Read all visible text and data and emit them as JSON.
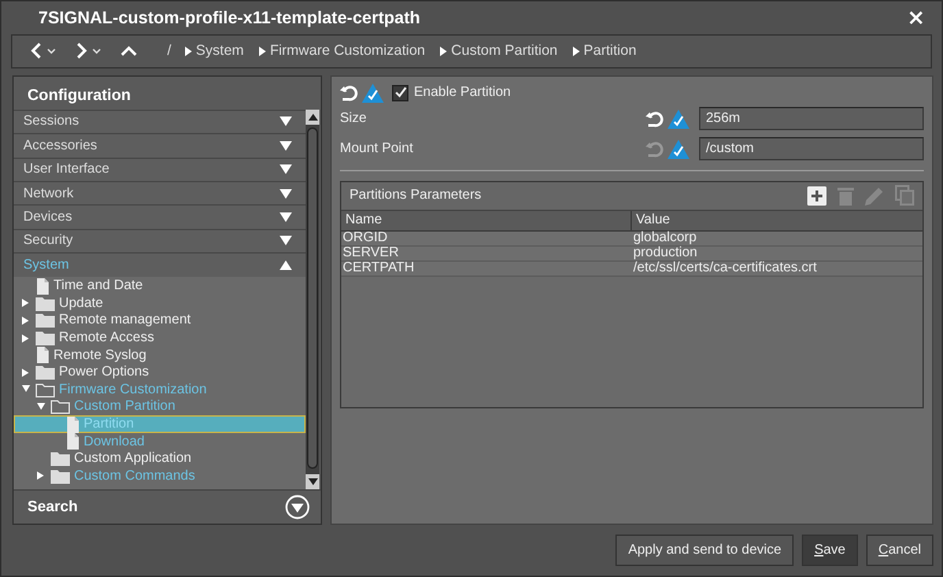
{
  "window": {
    "title": "7SIGNAL-custom-profile-x11-template-certpath",
    "close": "×"
  },
  "breadcrumb": {
    "root": "/",
    "items": [
      "System",
      "Firmware Customization",
      "Custom Partition",
      "Partition"
    ]
  },
  "sidebar": {
    "title": "Configuration",
    "categories": [
      {
        "label": "Sessions",
        "expanded": false
      },
      {
        "label": "Accessories",
        "expanded": false
      },
      {
        "label": "User Interface",
        "expanded": false
      },
      {
        "label": "Network",
        "expanded": false
      },
      {
        "label": "Devices",
        "expanded": false
      },
      {
        "label": "Security",
        "expanded": false
      },
      {
        "label": "System",
        "expanded": true
      }
    ],
    "tree": [
      {
        "label": "Time and Date",
        "kind": "file",
        "expandable": false,
        "modified": false,
        "selected": false
      },
      {
        "label": "Update",
        "kind": "folder",
        "expandable": true,
        "expanded": false,
        "modified": false,
        "selected": false
      },
      {
        "label": "Remote management",
        "kind": "folder",
        "expandable": true,
        "expanded": false,
        "modified": false,
        "selected": false
      },
      {
        "label": "Remote Access",
        "kind": "folder",
        "expandable": true,
        "expanded": false,
        "modified": false,
        "selected": false
      },
      {
        "label": "Remote Syslog",
        "kind": "file",
        "expandable": false,
        "modified": false,
        "selected": false
      },
      {
        "label": "Power Options",
        "kind": "folder",
        "expandable": true,
        "expanded": false,
        "modified": false,
        "selected": false
      },
      {
        "label": "Firmware Customization",
        "kind": "folder",
        "expandable": true,
        "expanded": true,
        "modified": true,
        "selected": false,
        "children": [
          {
            "label": "Custom Partition",
            "kind": "folder",
            "expandable": true,
            "expanded": true,
            "modified": true,
            "selected": false,
            "children": [
              {
                "label": "Partition",
                "kind": "file",
                "expandable": false,
                "modified": true,
                "selected": true
              },
              {
                "label": "Download",
                "kind": "file",
                "expandable": false,
                "modified": true,
                "selected": false
              }
            ]
          },
          {
            "label": "Custom Application",
            "kind": "folder",
            "expandable": false,
            "modified": false,
            "selected": false
          },
          {
            "label": "Custom Commands",
            "kind": "folder",
            "expandable": true,
            "expanded": false,
            "modified": true,
            "selected": false
          }
        ]
      }
    ],
    "search": "Search"
  },
  "enable_partition": {
    "label": "Enable Partition",
    "checked": true
  },
  "fields": [
    {
      "label": "Size",
      "value": "256m",
      "reset_enabled": true
    },
    {
      "label": "Mount Point",
      "value": "/custom",
      "reset_enabled": false
    }
  ],
  "parameters": {
    "title": "Partitions Parameters",
    "tools": [
      {
        "kind": "add",
        "disabled": false
      },
      {
        "kind": "delete",
        "disabled": true
      },
      {
        "kind": "edit",
        "disabled": true
      },
      {
        "kind": "copy",
        "disabled": true
      }
    ],
    "table": {
      "columns": [
        "Name",
        "Value"
      ],
      "rows": [
        [
          "ORGID",
          "globalcorp"
        ],
        [
          "SERVER",
          "production"
        ],
        [
          "CERTPATH",
          "/etc/ssl/certs/ca-certificates.crt"
        ]
      ]
    }
  },
  "buttons": [
    {
      "label": "Apply and send to device",
      "mnemonic": false,
      "default": false
    },
    {
      "label": "Save",
      "mnemonic": true,
      "default": true
    },
    {
      "label": "Cancel",
      "mnemonic": true,
      "default": false
    }
  ]
}
